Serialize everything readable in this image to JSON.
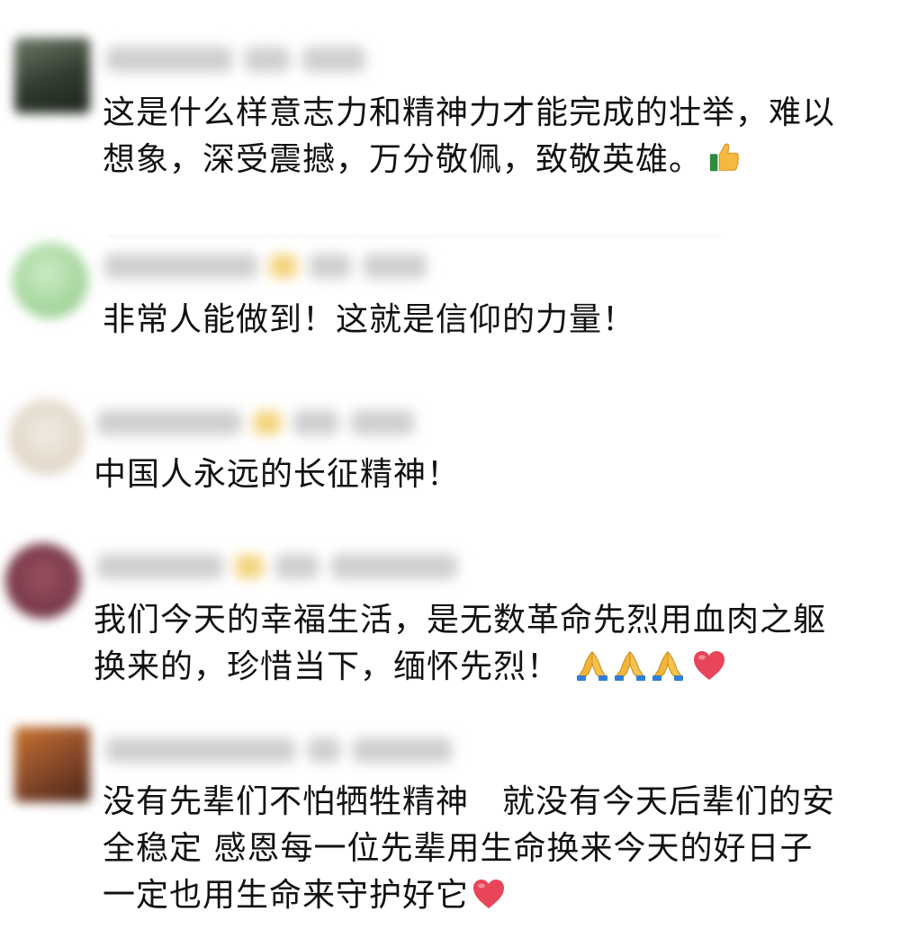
{
  "comments": [
    {
      "lines": [
        "这是什么样意志力和精神力才能完成的壮举，难以",
        "想象，深受震撼，万分敬佩，致敬英雄。"
      ],
      "emojis": [
        "thumbs-up"
      ],
      "avatar_color": "#3c4a3a"
    },
    {
      "lines": [
        "非常人能做到！这就是信仰的力量！"
      ],
      "emojis": [],
      "avatar_color": "#a8d8a0"
    },
    {
      "lines": [
        "中国人永远的长征精神！"
      ],
      "emojis": [],
      "avatar_color": "#e6ded2"
    },
    {
      "lines": [
        "我们今天的幸福生活，是无数革命先烈用血肉之躯",
        "换来的，珍惜当下，缅怀先烈！"
      ],
      "emojis": [
        "folded-hands",
        "folded-hands",
        "folded-hands",
        "red-heart"
      ],
      "avatar_color": "#7a3a4a"
    },
    {
      "lines": [
        "没有先辈们不怕牺牲精神　就没有今天后辈们的安",
        "全稳定 感恩每一位先辈用生命换来今天的好日子",
        "一定也用生命来守护好它"
      ],
      "emojis": [
        "red-heart"
      ],
      "avatar_color": "#8a4a2a"
    }
  ],
  "colors": {
    "text": "#111111",
    "background": "#ffffff",
    "heart": "#e8455a",
    "hands": "#f2b53a",
    "thumb": "#f5b942",
    "blurred_meta": "#cfcfcf"
  }
}
